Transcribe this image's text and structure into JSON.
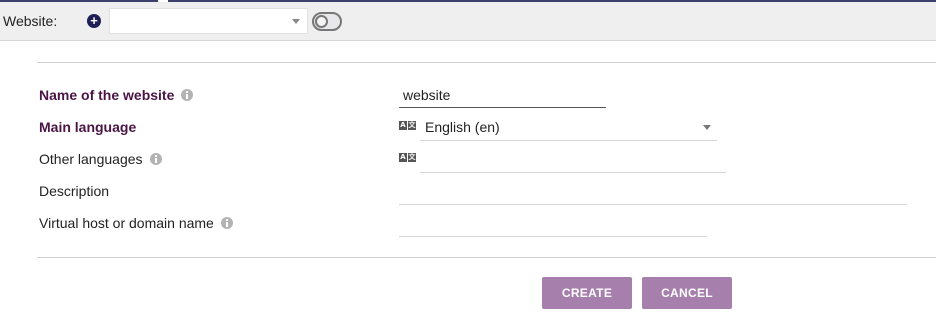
{
  "toolbar": {
    "website_label": "Website:",
    "add_icon": "plus-circle-icon",
    "website_select_value": "",
    "toggle_icon": "toggle-icon"
  },
  "form": {
    "name": {
      "label": "Name of the website",
      "value": "website",
      "info_icon": "info-icon"
    },
    "main_language": {
      "label": "Main language",
      "value": "English (en)",
      "icon": "language-icon"
    },
    "other_languages": {
      "label": "Other languages",
      "value": "",
      "info_icon": "info-icon",
      "icon": "language-icon"
    },
    "description": {
      "label": "Description",
      "value": ""
    },
    "virtual_host": {
      "label": "Virtual host or domain name",
      "value": "",
      "info_icon": "info-icon"
    }
  },
  "actions": {
    "create_label": "CREATE",
    "cancel_label": "CANCEL"
  },
  "colors": {
    "accent": "#a67fad",
    "required_label": "#4a1545",
    "toolbar_bg": "#efeff0",
    "add_icon": "#1e1f57"
  }
}
